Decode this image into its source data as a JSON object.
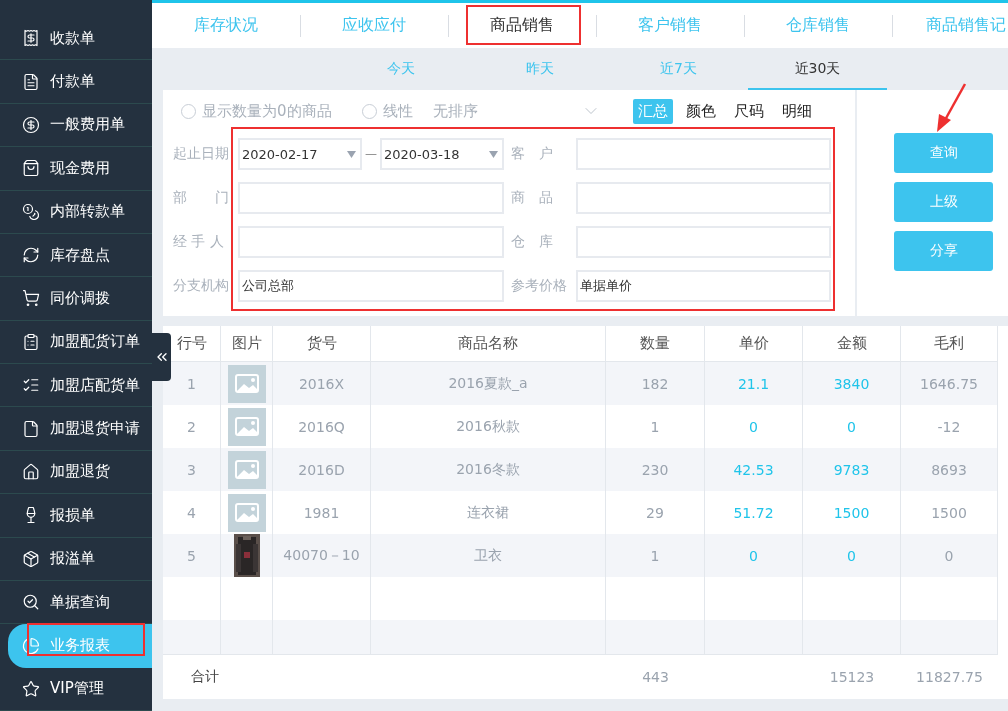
{
  "sidebar": {
    "items": [
      {
        "label": "收款单",
        "selected": false,
        "highlighted": false
      },
      {
        "label": "付款单",
        "selected": false,
        "highlighted": false
      },
      {
        "label": "一般费用单",
        "selected": false,
        "highlighted": false
      },
      {
        "label": "现金费用",
        "selected": false,
        "highlighted": false
      },
      {
        "label": "内部转款单",
        "selected": false,
        "highlighted": false
      },
      {
        "label": "库存盘点",
        "selected": false,
        "highlighted": false
      },
      {
        "label": "同价调拨",
        "selected": false,
        "highlighted": false
      },
      {
        "label": "加盟配货订单",
        "selected": false,
        "highlighted": false
      },
      {
        "label": "加盟店配货单",
        "selected": false,
        "highlighted": false
      },
      {
        "label": "加盟退货申请",
        "selected": false,
        "highlighted": false
      },
      {
        "label": "加盟退货",
        "selected": false,
        "highlighted": false
      },
      {
        "label": "报损单",
        "selected": false,
        "highlighted": false
      },
      {
        "label": "报溢单",
        "selected": false,
        "highlighted": false
      },
      {
        "label": "单据查询",
        "selected": false,
        "highlighted": false
      },
      {
        "label": "业务报表",
        "selected": true,
        "highlighted": true
      },
      {
        "label": "VIP管理",
        "selected": false,
        "highlighted": false
      }
    ]
  },
  "tabs": [
    {
      "label": "库存状况",
      "selected": false,
      "highlighted": false
    },
    {
      "label": "应收应付",
      "selected": false,
      "highlighted": false
    },
    {
      "label": "商品销售",
      "selected": true,
      "highlighted": true
    },
    {
      "label": "客户销售",
      "selected": false,
      "highlighted": false
    },
    {
      "label": "仓库销售",
      "selected": false,
      "highlighted": false
    },
    {
      "label": "商品销售记",
      "selected": false,
      "highlighted": false
    }
  ],
  "periods": [
    {
      "label": "今天",
      "selected": false
    },
    {
      "label": "昨天",
      "selected": false
    },
    {
      "label": "近7天",
      "selected": false
    },
    {
      "label": "近30天",
      "selected": true
    }
  ],
  "options": {
    "show_zero": {
      "label": "显示数量为0的商品",
      "checked": false
    },
    "linear": {
      "label": "线性",
      "checked": false
    },
    "sort": {
      "value": "无排序"
    }
  },
  "views": [
    {
      "label": "汇总",
      "selected": true
    },
    {
      "label": "颜色",
      "selected": false
    },
    {
      "label": "尺码",
      "selected": false
    },
    {
      "label": "明细",
      "selected": false
    }
  ],
  "filter_form": {
    "highlighted": true,
    "date_label": "起止日期",
    "date_from": "2020-02-17",
    "date_sep": "—",
    "date_to": "2020-03-18",
    "fields": [
      {
        "label": "客　户"
      },
      {
        "label": "部　　门"
      },
      {
        "label": "商　品"
      },
      {
        "label": "经 手 人"
      },
      {
        "label": "仓　库"
      },
      {
        "label": "分支机构",
        "value": "公司总部"
      },
      {
        "label": "参考价格",
        "value": "单据单价"
      }
    ]
  },
  "buttons": [
    {
      "label": "查询"
    },
    {
      "label": "上级"
    },
    {
      "label": "分享"
    }
  ],
  "arrow_annotation": true,
  "table": {
    "columns": [
      "行号",
      "图片",
      "货号",
      "商品名称",
      "数量",
      "单价",
      "金额",
      "毛利"
    ],
    "rows": [
      {
        "no": "1",
        "kind": "placeholder",
        "code": "2016X",
        "name": "2016夏款_a",
        "qty": "182",
        "price": "21.1",
        "amount": "3840",
        "profit": "1646.75"
      },
      {
        "no": "2",
        "kind": "placeholder",
        "code": "2016Q",
        "name": "2016秋款",
        "qty": "1",
        "price": "0",
        "amount": "0",
        "profit": "-12"
      },
      {
        "no": "3",
        "kind": "placeholder",
        "code": "2016D",
        "name": "2016冬款",
        "qty": "230",
        "price": "42.53",
        "amount": "9783",
        "profit": "8693"
      },
      {
        "no": "4",
        "kind": "placeholder",
        "code": "1981",
        "name": "连衣裙",
        "qty": "29",
        "price": "51.72",
        "amount": "1500",
        "profit": "1500"
      },
      {
        "no": "5",
        "kind": "picture",
        "code": "40070－10",
        "name": "卫衣",
        "qty": "1",
        "price": "0",
        "amount": "0",
        "profit": "0"
      }
    ],
    "totals": {
      "label": "合计",
      "qty": "443",
      "amount": "15123",
      "profit": "11827.75"
    }
  }
}
